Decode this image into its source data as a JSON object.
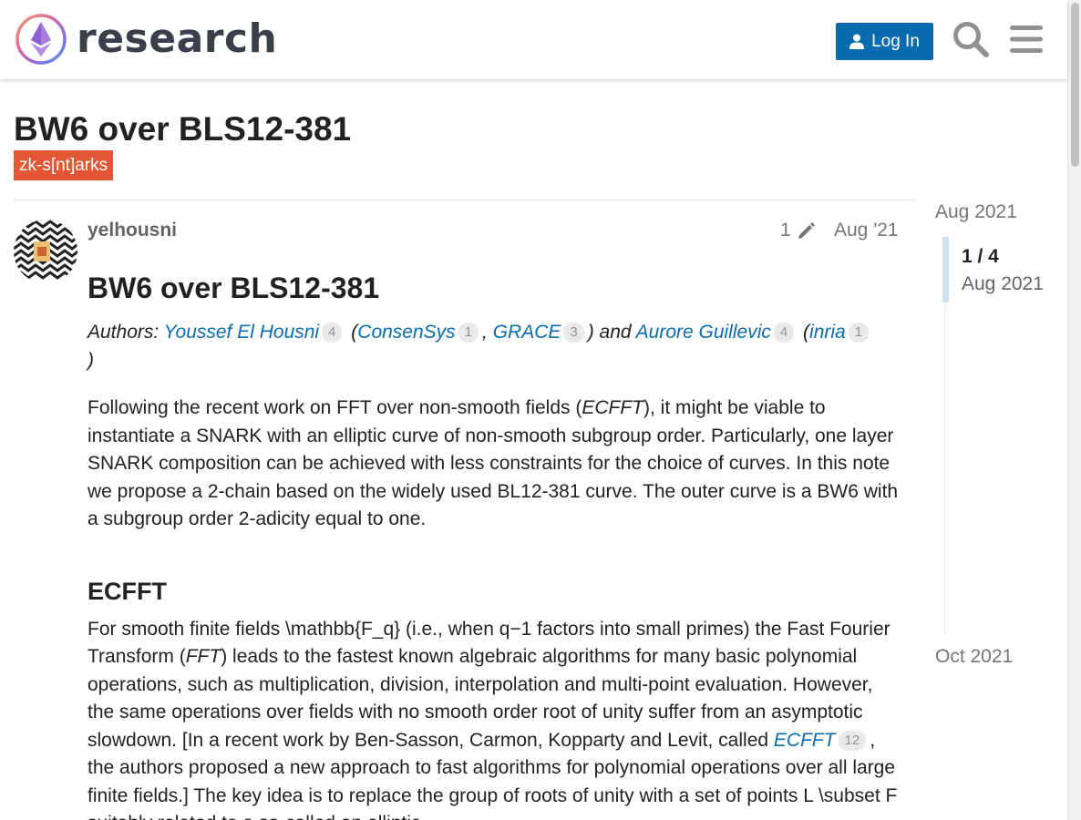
{
  "header": {
    "logo_text": "research",
    "login_label": "Log In",
    "icons": {
      "login": "user-icon",
      "search": "search-icon",
      "menu": "hamburger-menu-icon"
    }
  },
  "topic": {
    "title": "BW6 over BLS12-381",
    "tag": "zk-s[nt]arks"
  },
  "post": {
    "username": "yelhousni",
    "edit_count": "1",
    "date": "Aug '21",
    "heading": "BW6 over BLS12-381",
    "authors": {
      "prefix": "Authors: ",
      "author1": "Youssef El Housni",
      "author1_clicks": "4",
      "open1": " (",
      "affil1": "ConsenSys",
      "affil1_clicks": "1",
      "comma": ", ",
      "affil2": "GRACE",
      "affil2_clicks": "3",
      "close_and": ") and ",
      "author2": "Aurore Guillevic",
      "author2_clicks": "4",
      "open2": " (",
      "affil3": "inria",
      "affil3_clicks": "1",
      "close2": ")"
    },
    "intro": {
      "before": "Following the recent work on FFT over non-smooth fields (",
      "em": "ECFFT",
      "after": "), it might be viable to instantiate a SNARK with an elliptic curve of non-smooth subgroup order. Particularly, one layer SNARK composition can be achieved with less constraints for the choice of curves. In this note we propose a 2-chain based on the widely used BL12-381 curve. The outer curve is a BW6 with a subgroup order 2-adicity equal to one."
    },
    "section_heading": "ECFFT",
    "section_p": {
      "part1": "For smooth finite fields \\mathbb{F_q} (i.e., when q−1 factors into small primes) the Fast Fourier Transform (",
      "em": "FFT",
      "part2": ") leads to the fastest known algebraic algorithms for many basic polynomial operations, such as multiplication, division, interpolation and multi-point evaluation. However, the same operations over fields with no smooth order root of unity suffer from an asymptotic slowdown. [In a recent work by Ben-Sasson, Carmon, Kopparty and Levit, called ",
      "link": "ECFFT",
      "link_clicks": "12",
      "part3": ", the authors proposed a new approach to fast algorithms for polynomial operations over all large finite fields.] The key idea is to replace the group of roots of unity with a set of points L \\subset F suitably related to a so-called an elliptic"
    }
  },
  "timeline": {
    "start": "Aug 2021",
    "position": "1 / 4",
    "current_date": "Aug 2021",
    "end": "Oct 2021"
  },
  "colors": {
    "accent": "#0a6cb0",
    "tag": "#e45735"
  }
}
